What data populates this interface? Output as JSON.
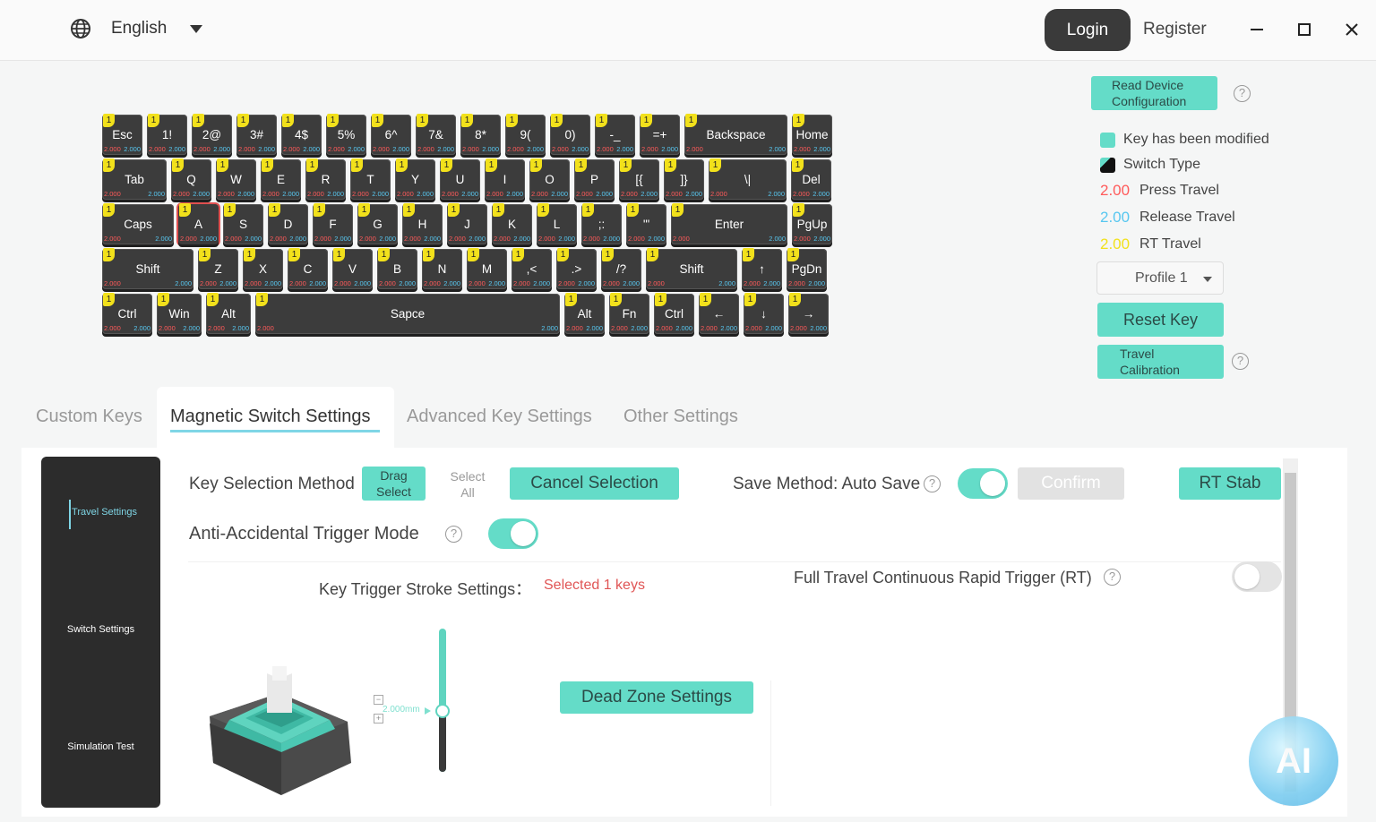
{
  "titlebar": {
    "language": "English",
    "login": "Login",
    "register": "Register",
    "icons": [
      "globe-icon",
      "chevron-down-icon",
      "minimize-icon",
      "maximize-icon",
      "close-icon"
    ]
  },
  "keyboard": {
    "default_press": "2.000",
    "default_release": "2.000",
    "badge": "1",
    "rows": [
      [
        "Esc",
        "1!",
        "2@",
        "3#",
        "4$",
        "5%",
        "6^",
        "7&",
        "8*",
        "9(",
        "0)",
        "-_",
        "=+",
        "Backspace",
        "Home"
      ],
      [
        "Tab",
        "Q",
        "W",
        "E",
        "R",
        "T",
        "Y",
        "U",
        "I",
        "O",
        "P",
        "[{",
        "]}",
        "\\|",
        "Del"
      ],
      [
        "Caps",
        "A",
        "S",
        "D",
        "F",
        "G",
        "H",
        "J",
        "K",
        "L",
        ";:",
        "'\"",
        "Enter",
        "PgUp"
      ],
      [
        "Shift",
        "Z",
        "X",
        "C",
        "V",
        "B",
        "N",
        "M",
        ",<",
        ".>",
        "/?",
        "Shift",
        "↑",
        "PgDn"
      ],
      [
        "Ctrl",
        "Win",
        "Alt",
        "Sapce",
        "Alt",
        "Fn",
        "Ctrl",
        "←",
        "↓",
        "→"
      ]
    ],
    "selected_key": "A"
  },
  "right_panel": {
    "read_config": "Read Device Configuration",
    "legend": {
      "modified": "Key has been modified",
      "switch_type": "Switch Type",
      "press_value": "2.00",
      "press_label": "Press Travel",
      "release_value": "2.00",
      "release_label": "Release Travel",
      "rt_value": "2.00",
      "rt_label": "RT Travel"
    },
    "profile": "Profile 1",
    "reset_key": "Reset Key",
    "travel_calibration": "Travel Calibration"
  },
  "tabs": [
    "Custom Keys",
    "Magnetic Switch Settings",
    "Advanced Key Settings",
    "Other Settings"
  ],
  "sidenav": [
    "Travel Settings",
    "Switch Settings",
    "Simulation Test"
  ],
  "settings": {
    "key_selection_method": "Key Selection Method",
    "drag_select": "Drag Select",
    "select_all": "Select All",
    "cancel_selection": "Cancel Selection",
    "save_method": "Save Method: Auto Save",
    "confirm": "Confirm",
    "rt_stab": "RT Stab",
    "anti_accidental": "Anti-Accidental Trigger Mode",
    "stroke_settings": "Key Trigger Stroke Settings：",
    "selected_keys": "Selected 1 keys",
    "full_travel_rt": "Full Travel Continuous Rapid Trigger (RT)",
    "slider_value": "2.000mm",
    "dead_zone": "Dead Zone Settings",
    "ai": "AI"
  },
  "colors": {
    "accent": "#64dcc8",
    "press": "#ff5a5a",
    "release": "#58c7f0",
    "rt": "#f2e11b"
  }
}
